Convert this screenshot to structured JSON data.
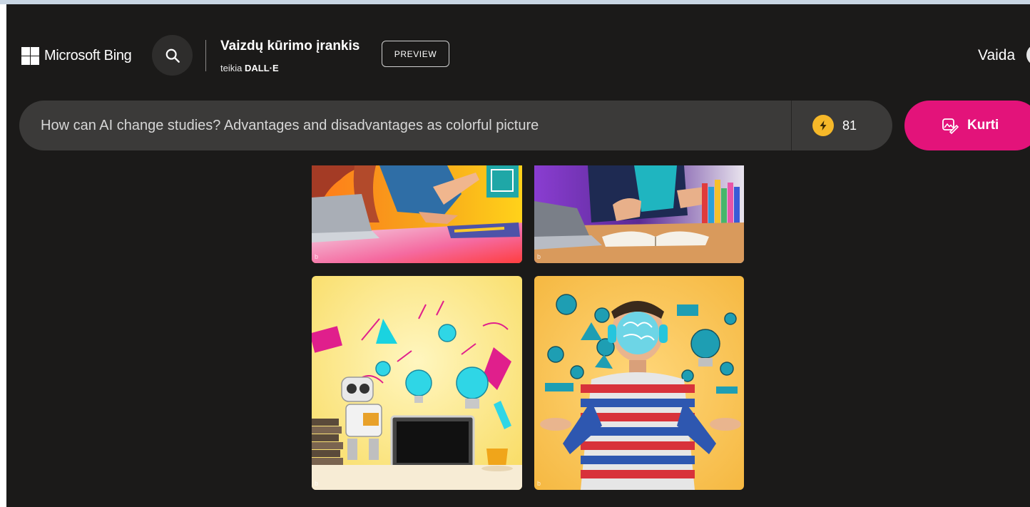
{
  "header": {
    "brand": "Microsoft Bing",
    "tool_title": "Vaizdų kūrimo įrankis",
    "tool_sub_prefix": "teikia",
    "tool_sub_brand": "DALL·E",
    "badge": "PREVIEW",
    "user_name": "Vaida"
  },
  "prompt": {
    "value": "How can AI change studies? Advantages and disadvantages as colorful picture",
    "boosts": "81",
    "create_label": "Kurti"
  },
  "icons": {
    "search": "search-icon",
    "boost": "lightning-icon",
    "create": "image-create-icon"
  },
  "colors": {
    "background": "#1b1a19",
    "prompt_bar": "#3b3a39",
    "create_button": "#e3137a",
    "boost_coin": "#f6b829"
  },
  "images": [
    {
      "id": "result-1",
      "watermark": "b"
    },
    {
      "id": "result-2",
      "watermark": "b"
    },
    {
      "id": "result-3",
      "watermark": "b"
    },
    {
      "id": "result-4",
      "watermark": "b"
    }
  ]
}
